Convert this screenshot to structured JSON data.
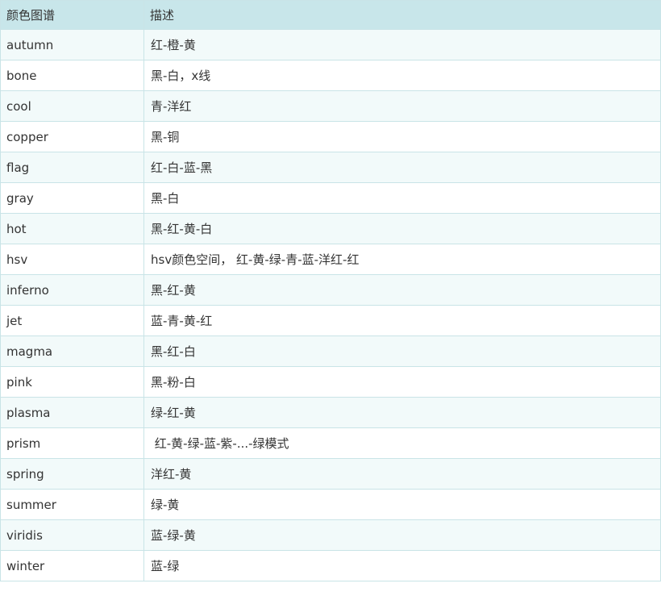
{
  "table": {
    "headers": [
      "颜色图谱",
      "描述"
    ],
    "rows": [
      [
        "autumn",
        "红-橙-黄"
      ],
      [
        "bone",
        "黑-白，x线"
      ],
      [
        "cool",
        "青-洋红"
      ],
      [
        "copper",
        "黑-铜"
      ],
      [
        "flag",
        "红-白-蓝-黑"
      ],
      [
        "gray",
        "黑-白"
      ],
      [
        "hot",
        "黑-红-黄-白"
      ],
      [
        "hsv",
        "hsv颜色空间， 红-黄-绿-青-蓝-洋红-红"
      ],
      [
        "inferno",
        "黑-红-黄"
      ],
      [
        "jet",
        "蓝-青-黄-红"
      ],
      [
        "magma",
        "黑-红-白"
      ],
      [
        "pink",
        "黑-粉-白"
      ],
      [
        "plasma",
        "绿-红-黄"
      ],
      [
        "prism",
        " 红-黄-绿-蓝-紫-...-绿模式"
      ],
      [
        "spring",
        "洋红-黄"
      ],
      [
        "summer",
        "绿-黄"
      ],
      [
        "viridis",
        "蓝-绿-黄"
      ],
      [
        "winter",
        "蓝-绿"
      ]
    ]
  }
}
